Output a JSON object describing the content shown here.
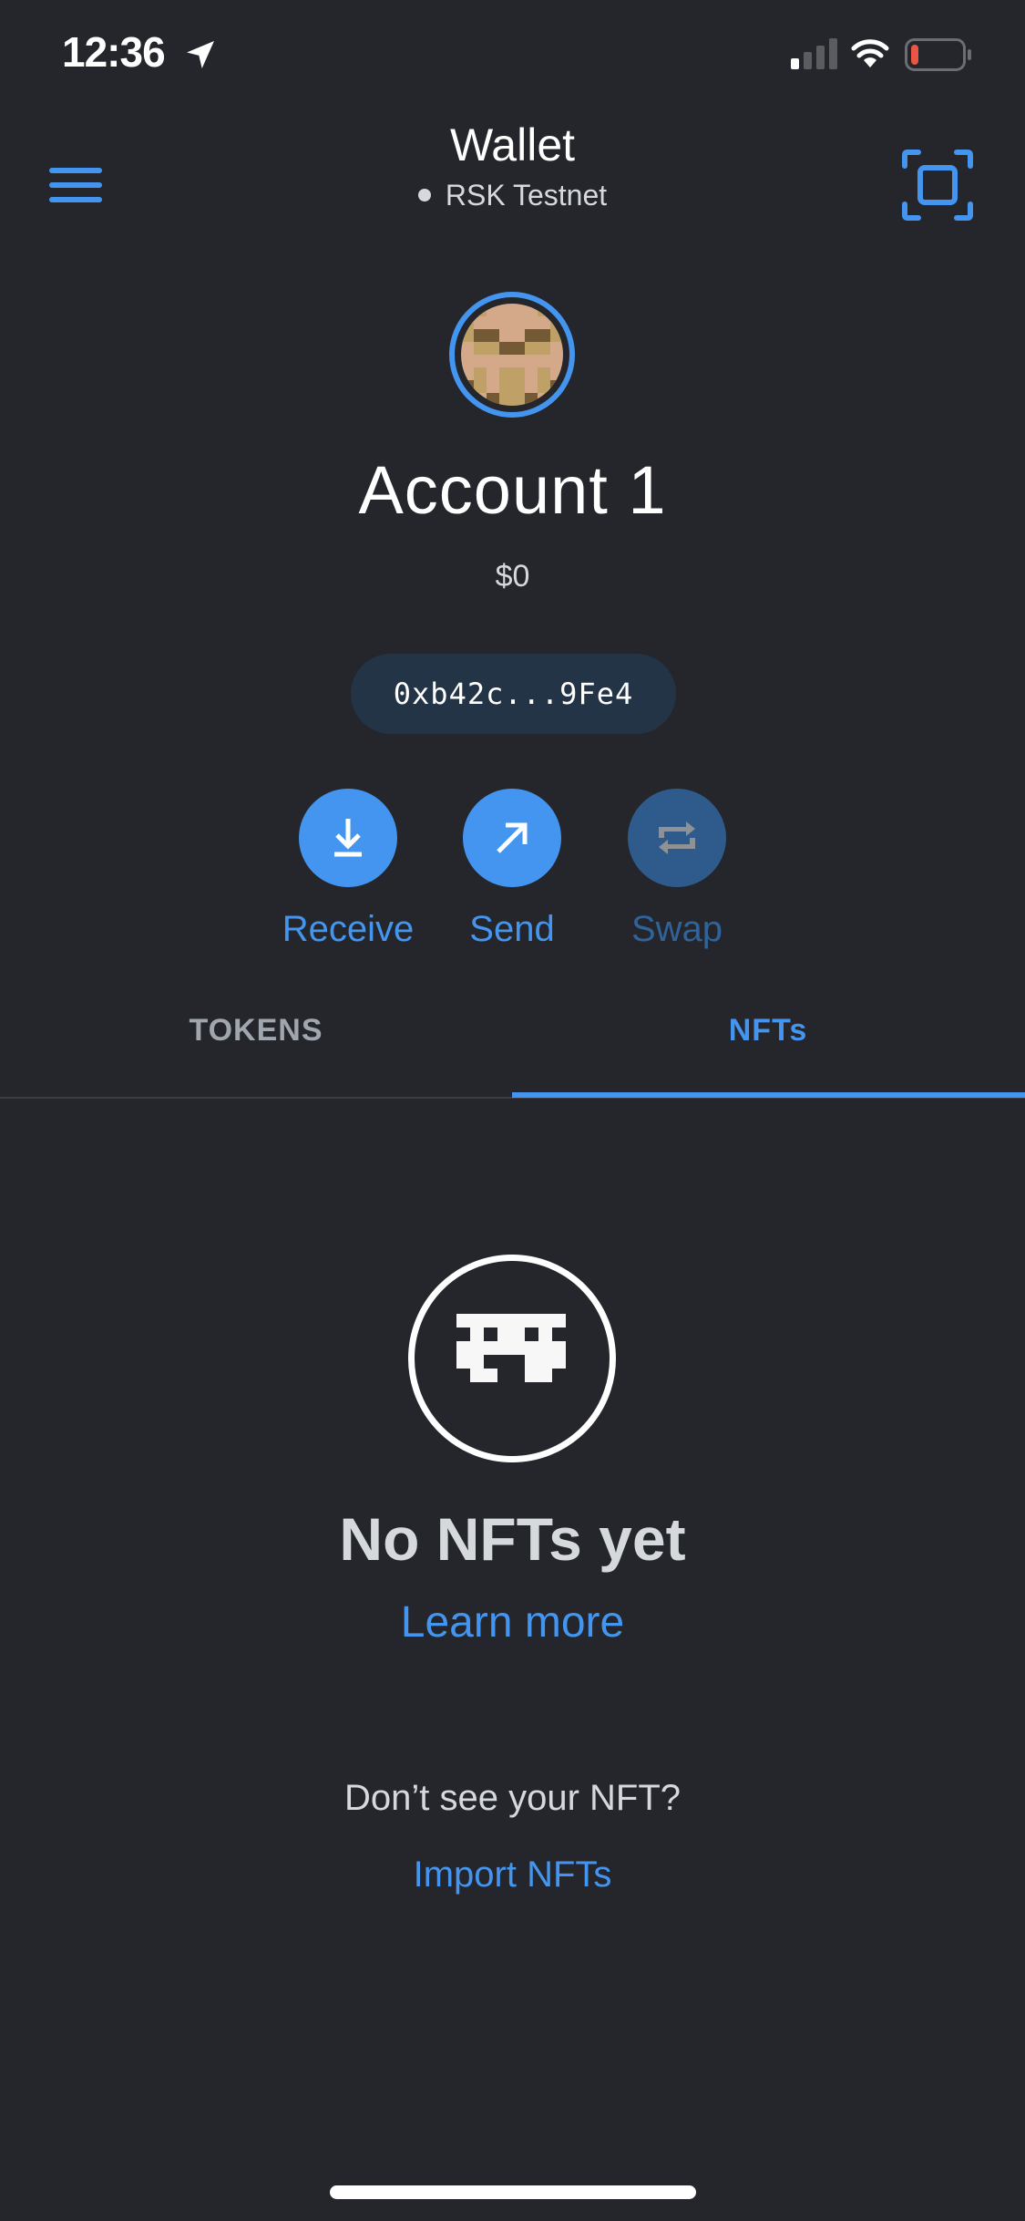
{
  "status_bar": {
    "time": "12:36",
    "location_icon": "location-arrow-icon",
    "signal_icon": "cellular-signal-icon",
    "signal_bars_active": 1,
    "signal_bars_total": 4,
    "wifi_icon": "wifi-icon",
    "battery_icon": "battery-icon",
    "battery_level": 0.1,
    "battery_color": "#eb5545"
  },
  "header": {
    "menu_icon": "hamburger-menu-icon",
    "title": "Wallet",
    "network": "RSK Testnet",
    "scan_icon": "qr-scan-icon"
  },
  "account": {
    "avatar_icon": "identicon-avatar",
    "name": "Account 1",
    "balance": "$0",
    "address": "0xb42c...9Fe4"
  },
  "actions": [
    {
      "label": "Receive",
      "icon": "receive-arrow-down-icon",
      "enabled": true
    },
    {
      "label": "Send",
      "icon": "send-arrow-up-right-icon",
      "enabled": true
    },
    {
      "label": "Swap",
      "icon": "swap-arrows-icon",
      "enabled": false
    }
  ],
  "tabs": [
    {
      "label": "TOKENS",
      "active": false
    },
    {
      "label": "NFTs",
      "active": true
    }
  ],
  "empty_state": {
    "icon": "space-invader-icon",
    "title": "No NFTs yet",
    "learn_more": "Learn more",
    "prompt": "Don’t see your NFT?",
    "import_link": "Import NFTs"
  },
  "colors": {
    "background": "#24262b",
    "accent": "#4495ef",
    "accent_disabled": "#2e5b8c",
    "address_pill": "#243447",
    "text_primary": "#ffffff",
    "text_secondary": "#d6d9dc",
    "tab_inactive": "#9fa6ae"
  }
}
